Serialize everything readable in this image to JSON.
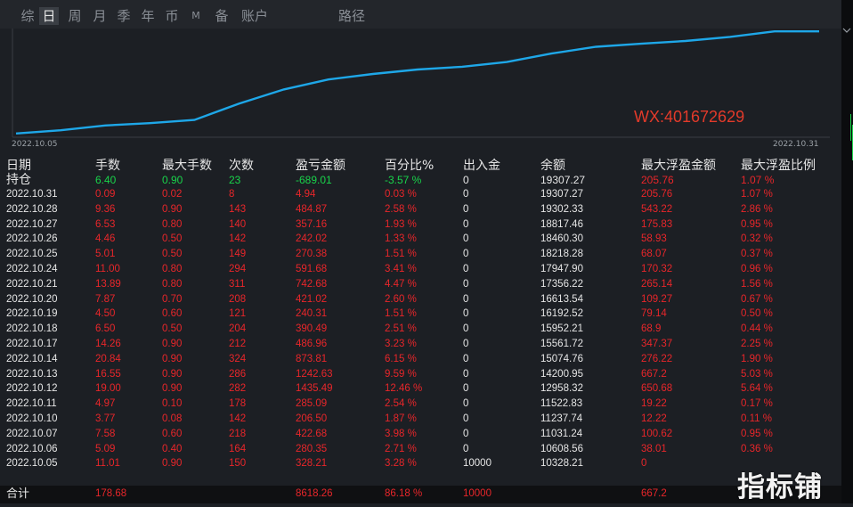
{
  "tabs": [
    {
      "label": "综",
      "active": false
    },
    {
      "label": "日",
      "active": true
    },
    {
      "label": "周",
      "active": false
    },
    {
      "label": "月",
      "active": false
    },
    {
      "label": "季",
      "active": false
    },
    {
      "label": "年",
      "active": false
    },
    {
      "label": "币",
      "active": false
    },
    {
      "label": "M",
      "active": false
    },
    {
      "label": "备",
      "active": false
    },
    {
      "label": "账户",
      "active": false
    },
    {
      "label": "路径",
      "active": false
    }
  ],
  "colors": {
    "line": "#1ea7e8",
    "red": "#e8262a",
    "green": "#19d34a",
    "background": "#1c1f24"
  },
  "chart_data": {
    "type": "line",
    "x_start": "2022.10.05",
    "x_end": "2022.10.31",
    "x": [
      "2022.10.05",
      "2022.10.06",
      "2022.10.07",
      "2022.10.10",
      "2022.10.11",
      "2022.10.12",
      "2022.10.13",
      "2022.10.14",
      "2022.10.17",
      "2022.10.18",
      "2022.10.19",
      "2022.10.20",
      "2022.10.21",
      "2022.10.24",
      "2022.10.25",
      "2022.10.26",
      "2022.10.27",
      "2022.10.28",
      "2022.10.31"
    ],
    "values": [
      10328.21,
      10608.56,
      11031.24,
      11237.74,
      11522.83,
      12958.32,
      14200.95,
      15074.76,
      15561.72,
      15952.21,
      16192.52,
      16613.54,
      17356.22,
      17947.9,
      18218.28,
      18460.3,
      18817.46,
      19302.33,
      19307.27
    ],
    "annotation": "WX:401672629"
  },
  "table": {
    "headers": [
      "日期",
      "手数",
      "最大手数",
      "次数",
      "盈亏金额",
      "百分比%",
      "出入金",
      "余额",
      "最大浮盈金额",
      "最大浮盈比例"
    ],
    "holding": [
      "持仓",
      "6.40",
      "0.90",
      "23",
      "-689.01",
      "-3.57 %",
      "0",
      "19307.27",
      "205.76",
      "1.07 %"
    ],
    "rows": [
      [
        "2022.10.31",
        "0.09",
        "0.02",
        "8",
        "4.94",
        "0.03 %",
        "0",
        "19307.27",
        "205.76",
        "1.07 %"
      ],
      [
        "2022.10.28",
        "9.36",
        "0.90",
        "143",
        "484.87",
        "2.58 %",
        "0",
        "19302.33",
        "543.22",
        "2.86 %"
      ],
      [
        "2022.10.27",
        "6.53",
        "0.80",
        "140",
        "357.16",
        "1.93 %",
        "0",
        "18817.46",
        "175.83",
        "0.95 %"
      ],
      [
        "2022.10.26",
        "4.46",
        "0.50",
        "142",
        "242.02",
        "1.33 %",
        "0",
        "18460.30",
        "58.93",
        "0.32 %"
      ],
      [
        "2022.10.25",
        "5.01",
        "0.50",
        "149",
        "270.38",
        "1.51 %",
        "0",
        "18218.28",
        "68.07",
        "0.37 %"
      ],
      [
        "2022.10.24",
        "11.00",
        "0.80",
        "294",
        "591.68",
        "3.41 %",
        "0",
        "17947.90",
        "170.32",
        "0.96 %"
      ],
      [
        "2022.10.21",
        "13.89",
        "0.80",
        "311",
        "742.68",
        "4.47 %",
        "0",
        "17356.22",
        "265.14",
        "1.56 %"
      ],
      [
        "2022.10.20",
        "7.87",
        "0.70",
        "208",
        "421.02",
        "2.60 %",
        "0",
        "16613.54",
        "109.27",
        "0.67 %"
      ],
      [
        "2022.10.19",
        "4.50",
        "0.60",
        "121",
        "240.31",
        "1.51 %",
        "0",
        "16192.52",
        "79.14",
        "0.50 %"
      ],
      [
        "2022.10.18",
        "6.50",
        "0.50",
        "204",
        "390.49",
        "2.51 %",
        "0",
        "15952.21",
        "68.9",
        "0.44 %"
      ],
      [
        "2022.10.17",
        "14.26",
        "0.90",
        "212",
        "486.96",
        "3.23 %",
        "0",
        "15561.72",
        "347.37",
        "2.25 %"
      ],
      [
        "2022.10.14",
        "20.84",
        "0.90",
        "324",
        "873.81",
        "6.15 %",
        "0",
        "15074.76",
        "276.22",
        "1.90 %"
      ],
      [
        "2022.10.13",
        "16.55",
        "0.90",
        "286",
        "1242.63",
        "9.59 %",
        "0",
        "14200.95",
        "667.2",
        "5.03 %"
      ],
      [
        "2022.10.12",
        "19.00",
        "0.90",
        "282",
        "1435.49",
        "12.46 %",
        "0",
        "12958.32",
        "650.68",
        "5.64 %"
      ],
      [
        "2022.10.11",
        "4.97",
        "0.10",
        "178",
        "285.09",
        "2.54 %",
        "0",
        "11522.83",
        "19.22",
        "0.17 %"
      ],
      [
        "2022.10.10",
        "3.77",
        "0.08",
        "142",
        "206.50",
        "1.87 %",
        "0",
        "11237.74",
        "12.22",
        "0.11 %"
      ],
      [
        "2022.10.07",
        "7.58",
        "0.60",
        "218",
        "422.68",
        "3.98 %",
        "0",
        "11031.24",
        "100.62",
        "0.95 %"
      ],
      [
        "2022.10.06",
        "5.09",
        "0.40",
        "164",
        "280.35",
        "2.71 %",
        "0",
        "10608.56",
        "38.01",
        "0.36 %"
      ],
      [
        "2022.10.05",
        "11.01",
        "0.90",
        "150",
        "328.21",
        "3.28 %",
        "10000",
        "10328.21",
        "0",
        ""
      ]
    ],
    "total": [
      "合计",
      "178.68",
      "",
      "",
      "8618.26",
      "86.18 %",
      "10000",
      "",
      "667.2",
      ""
    ]
  },
  "watermark": "指标铺"
}
